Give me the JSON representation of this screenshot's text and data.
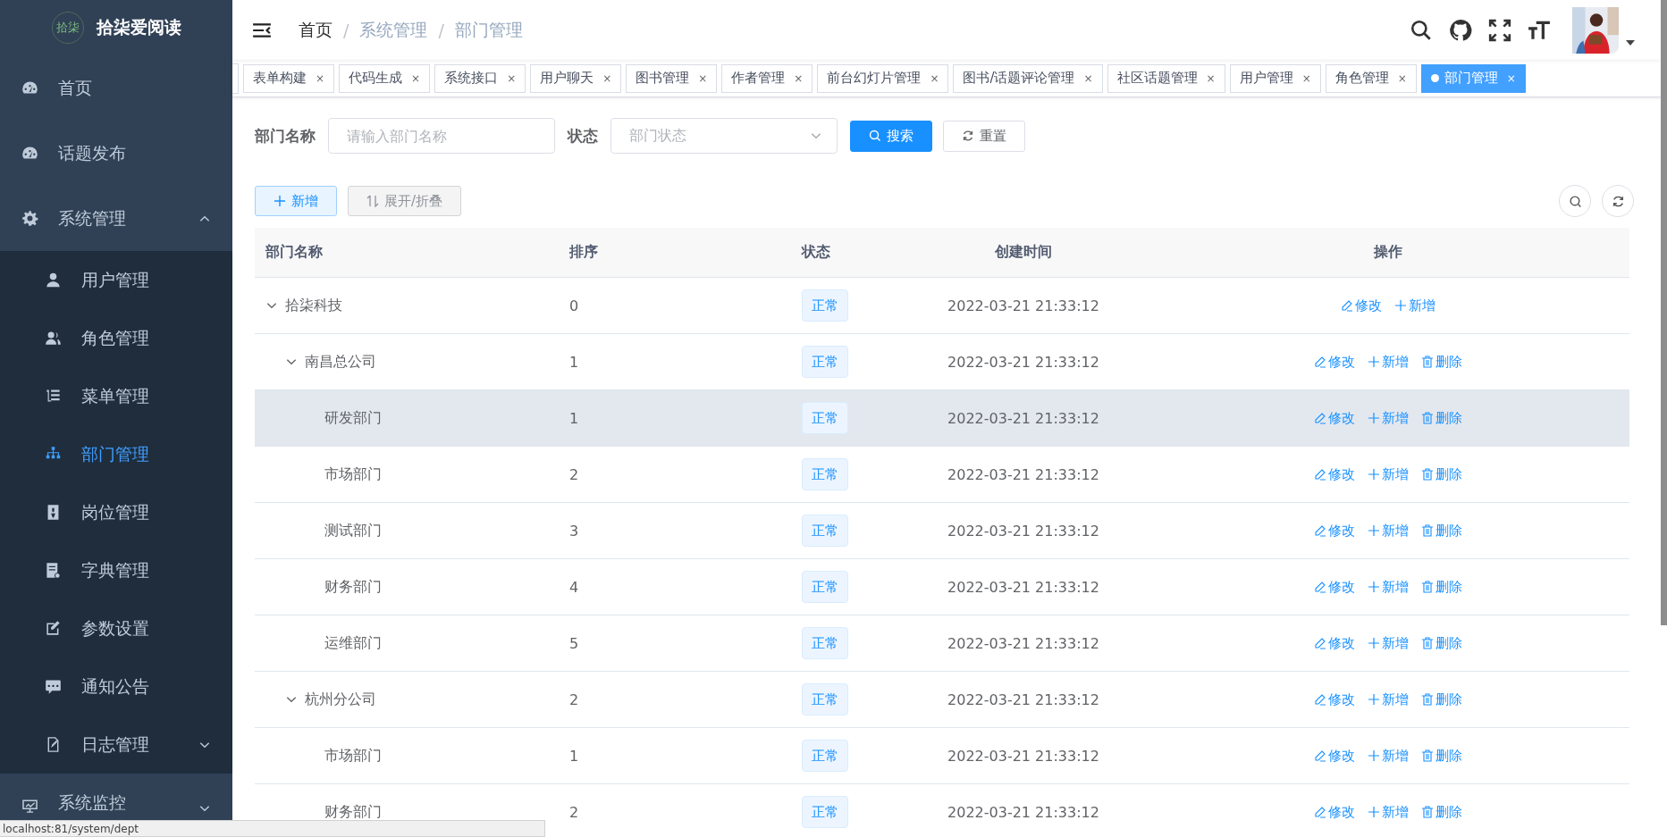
{
  "sidebar": {
    "logo_mark": "拾柒",
    "logo_text": "拾柒爱阅读",
    "items": [
      {
        "label": "首页",
        "selected": false
      },
      {
        "label": "话题发布",
        "selected": false
      },
      {
        "label": "系统管理",
        "selected": false,
        "expanded": true,
        "children": [
          {
            "label": "用户管理",
            "selected": false
          },
          {
            "label": "角色管理",
            "selected": false
          },
          {
            "label": "菜单管理",
            "selected": false
          },
          {
            "label": "部门管理",
            "selected": true
          },
          {
            "label": "岗位管理",
            "selected": false
          },
          {
            "label": "字典管理",
            "selected": false
          },
          {
            "label": "参数设置",
            "selected": false
          },
          {
            "label": "通知公告",
            "selected": false
          },
          {
            "label": "日志管理",
            "selected": false,
            "expanded": false
          }
        ]
      },
      {
        "label": "系统监控",
        "selected": false,
        "expanded": false
      }
    ]
  },
  "breadcrumb": {
    "items": [
      "首页",
      "系统管理",
      "部门管理"
    ],
    "separators": [
      "/",
      "/"
    ]
  },
  "tabs": [
    {
      "label": "表单构建",
      "close": "×",
      "selected": false
    },
    {
      "label": "代码生成",
      "close": "×",
      "selected": false
    },
    {
      "label": "系统接口",
      "close": "×",
      "selected": false
    },
    {
      "label": "用户聊天",
      "close": "×",
      "selected": false
    },
    {
      "label": "图书管理",
      "close": "×",
      "selected": false
    },
    {
      "label": "作者管理",
      "close": "×",
      "selected": false
    },
    {
      "label": "前台幻灯片管理",
      "close": "×",
      "selected": false
    },
    {
      "label": "图书/话题评论管理",
      "close": "×",
      "selected": false
    },
    {
      "label": "社区话题管理",
      "close": "×",
      "selected": false
    },
    {
      "label": "用户管理",
      "close": "×",
      "selected": false
    },
    {
      "label": "角色管理",
      "close": "×",
      "selected": false
    },
    {
      "label": "部门管理",
      "close": "×",
      "selected": true
    }
  ],
  "search": {
    "name_label": "部门名称",
    "name_placeholder": "请输入部门名称",
    "status_label": "状态",
    "status_placeholder": "部门状态",
    "search_button": "搜索",
    "reset_button": "重置"
  },
  "toolbar": {
    "add_button": "新增",
    "toggle_button": "展开/折叠"
  },
  "table": {
    "columns": [
      "部门名称",
      "排序",
      "状态",
      "创建时间",
      "操作"
    ],
    "rows": [
      {
        "name": "拾柒科技",
        "order": "0",
        "status": "正常",
        "created": "2022-03-21 21:33:12",
        "hovered": false,
        "expanded": true,
        "actions": [
          {
            "kind": "edit",
            "label": "修改"
          },
          {
            "kind": "add",
            "label": "新增"
          }
        ],
        "children": [
          {
            "name": "南昌总公司",
            "order": "1",
            "status": "正常",
            "created": "2022-03-21 21:33:12",
            "hovered": false,
            "expanded": true,
            "actions": [
              {
                "kind": "edit",
                "label": "修改"
              },
              {
                "kind": "add",
                "label": "新增"
              },
              {
                "kind": "delete",
                "label": "删除"
              }
            ],
            "children": [
              {
                "name": "研发部门",
                "order": "1",
                "status": "正常",
                "created": "2022-03-21 21:33:12",
                "hovered": true,
                "actions": [
                  {
                    "kind": "edit",
                    "label": "修改"
                  },
                  {
                    "kind": "add",
                    "label": "新增"
                  },
                  {
                    "kind": "delete",
                    "label": "删除"
                  }
                ]
              },
              {
                "name": "市场部门",
                "order": "2",
                "status": "正常",
                "created": "2022-03-21 21:33:12",
                "hovered": false,
                "actions": [
                  {
                    "kind": "edit",
                    "label": "修改"
                  },
                  {
                    "kind": "add",
                    "label": "新增"
                  },
                  {
                    "kind": "delete",
                    "label": "删除"
                  }
                ]
              },
              {
                "name": "测试部门",
                "order": "3",
                "status": "正常",
                "created": "2022-03-21 21:33:12",
                "hovered": false,
                "actions": [
                  {
                    "kind": "edit",
                    "label": "修改"
                  },
                  {
                    "kind": "add",
                    "label": "新增"
                  },
                  {
                    "kind": "delete",
                    "label": "删除"
                  }
                ]
              },
              {
                "name": "财务部门",
                "order": "4",
                "status": "正常",
                "created": "2022-03-21 21:33:12",
                "hovered": false,
                "actions": [
                  {
                    "kind": "edit",
                    "label": "修改"
                  },
                  {
                    "kind": "add",
                    "label": "新增"
                  },
                  {
                    "kind": "delete",
                    "label": "删除"
                  }
                ]
              },
              {
                "name": "运维部门",
                "order": "5",
                "status": "正常",
                "created": "2022-03-21 21:33:12",
                "hovered": false,
                "actions": [
                  {
                    "kind": "edit",
                    "label": "修改"
                  },
                  {
                    "kind": "add",
                    "label": "新增"
                  },
                  {
                    "kind": "delete",
                    "label": "删除"
                  }
                ]
              }
            ]
          },
          {
            "name": "杭州分公司",
            "order": "2",
            "status": "正常",
            "created": "2022-03-21 21:33:12",
            "hovered": false,
            "expanded": true,
            "actions": [
              {
                "kind": "edit",
                "label": "修改"
              },
              {
                "kind": "add",
                "label": "新增"
              },
              {
                "kind": "delete",
                "label": "删除"
              }
            ],
            "children": [
              {
                "name": "市场部门",
                "order": "1",
                "status": "正常",
                "created": "2022-03-21 21:33:12",
                "hovered": false,
                "actions": [
                  {
                    "kind": "edit",
                    "label": "修改"
                  },
                  {
                    "kind": "add",
                    "label": "新增"
                  },
                  {
                    "kind": "delete",
                    "label": "删除"
                  }
                ]
              },
              {
                "name": "财务部门",
                "order": "2",
                "status": "正常",
                "created": "2022-03-21 21:33:12",
                "hovered": false,
                "actions": [
                  {
                    "kind": "edit",
                    "label": "修改"
                  },
                  {
                    "kind": "add",
                    "label": "新增"
                  },
                  {
                    "kind": "delete",
                    "label": "删除"
                  }
                ]
              }
            ]
          }
        ]
      }
    ]
  },
  "status_url": "localhost:81/system/dept"
}
